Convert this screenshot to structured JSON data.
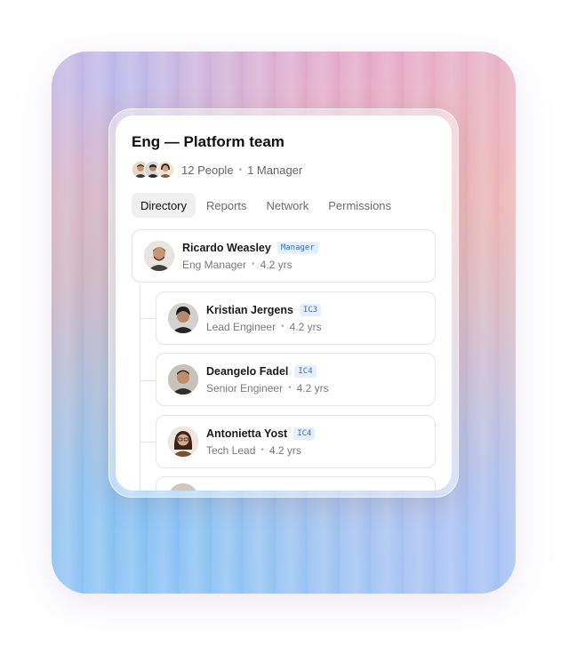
{
  "team": {
    "title": "Eng — Platform team",
    "people_count": "12 People",
    "manager_count": "1 Manager"
  },
  "tabs": [
    {
      "label": "Directory",
      "active": true
    },
    {
      "label": "Reports",
      "active": false
    },
    {
      "label": "Network",
      "active": false
    },
    {
      "label": "Permissions",
      "active": false
    }
  ],
  "members": [
    {
      "name": "Ricardo Weasley",
      "level": "Manager",
      "role": "Eng Manager",
      "tenure": "4.2 yrs"
    },
    {
      "name": "Kristian Jergens",
      "level": "IC3",
      "role": "Lead Engineer",
      "tenure": "4.2 yrs"
    },
    {
      "name": "Deangelo Fadel",
      "level": "IC4",
      "role": "Senior Engineer",
      "tenure": "4.2 yrs"
    },
    {
      "name": "Antonietta Yost",
      "level": "IC4",
      "role": "Tech Lead",
      "tenure": "4.2 yrs"
    }
  ],
  "colors": {
    "badge_text": "#3b6fc4",
    "badge_bg": "#e6efff",
    "active_tab_bg": "#f0f0f0"
  },
  "icons": {
    "avatar_stack": "people-avatars"
  }
}
